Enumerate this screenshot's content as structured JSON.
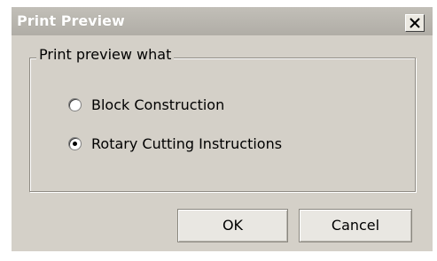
{
  "window": {
    "title": "Print Preview"
  },
  "group": {
    "legend": "Print preview what",
    "options": [
      {
        "label": "Block Construction",
        "selected": false
      },
      {
        "label": "Rotary Cutting Instructions",
        "selected": true
      }
    ]
  },
  "buttons": {
    "ok": "OK",
    "cancel": "Cancel"
  },
  "icons": {
    "close": "close-icon"
  }
}
